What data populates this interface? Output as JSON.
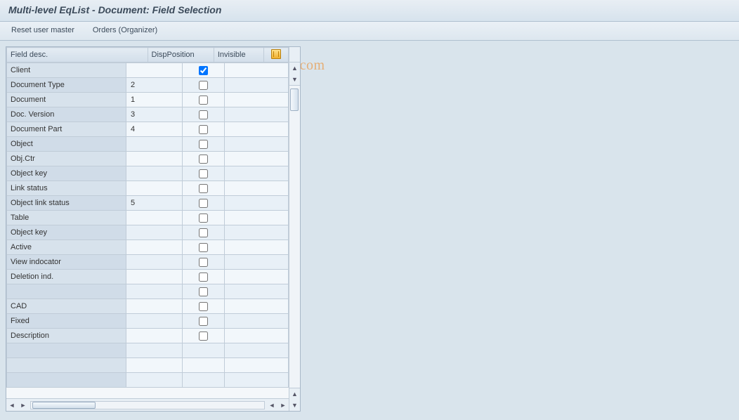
{
  "title": "Multi-level EqList - Document: Field Selection",
  "toolbar": {
    "reset_user_master": "Reset user master",
    "orders_organizer": "Orders (Organizer)"
  },
  "watermark": "© www.tutorialkart.com",
  "table": {
    "columns": {
      "field_desc": "Field desc.",
      "disp_position": "DispPosition",
      "invisible": "Invisible"
    },
    "rows": [
      {
        "desc": "Client",
        "pos": "",
        "invisible": true
      },
      {
        "desc": "Document Type",
        "pos": "2",
        "invisible": false
      },
      {
        "desc": "Document",
        "pos": "1",
        "invisible": false
      },
      {
        "desc": "Doc. Version",
        "pos": "3",
        "invisible": false
      },
      {
        "desc": "Document Part",
        "pos": "4",
        "invisible": false
      },
      {
        "desc": "Object",
        "pos": "",
        "invisible": false
      },
      {
        "desc": "Obj.Ctr",
        "pos": "",
        "invisible": false
      },
      {
        "desc": "Object key",
        "pos": "",
        "invisible": false
      },
      {
        "desc": "Link status",
        "pos": "",
        "invisible": false
      },
      {
        "desc": "Object link status",
        "pos": "5",
        "invisible": false
      },
      {
        "desc": "Table",
        "pos": "",
        "invisible": false
      },
      {
        "desc": "Object key",
        "pos": "",
        "invisible": false
      },
      {
        "desc": "Active",
        "pos": "",
        "invisible": false
      },
      {
        "desc": "View indocator",
        "pos": "",
        "invisible": false
      },
      {
        "desc": "Deletion ind.",
        "pos": "",
        "invisible": false
      },
      {
        "desc": "",
        "pos": "",
        "invisible": false
      },
      {
        "desc": "CAD",
        "pos": "",
        "invisible": false
      },
      {
        "desc": "Fixed",
        "pos": "",
        "invisible": false
      },
      {
        "desc": "Description",
        "pos": "",
        "invisible": false
      },
      {
        "desc": "",
        "pos": "",
        "invisible": null
      },
      {
        "desc": "",
        "pos": "",
        "invisible": null
      },
      {
        "desc": "",
        "pos": "",
        "invisible": null
      }
    ]
  }
}
